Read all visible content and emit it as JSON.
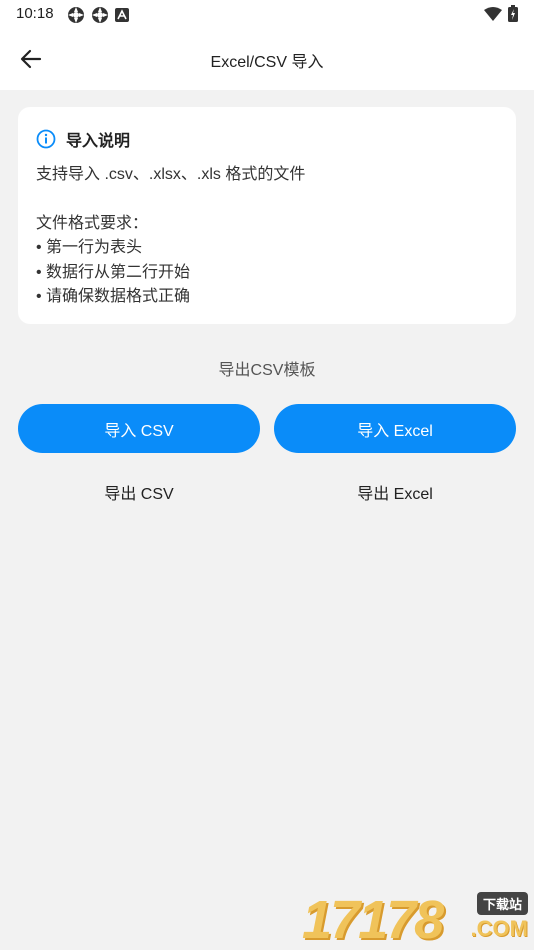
{
  "status_bar": {
    "time": "10:18",
    "left_icons": [
      "gear-icon",
      "gear-icon",
      "a-icon"
    ],
    "right_icons": [
      "wifi-icon",
      "battery-icon"
    ]
  },
  "app_bar": {
    "back_icon": "arrow-left-icon",
    "title": "Excel/CSV 导入"
  },
  "info_card": {
    "icon": "info-icon",
    "icon_color": "#0a8cf9",
    "title": "导入说明",
    "support_line": "支持导入 .csv、.xlsx、.xls 格式的文件",
    "requirements_heading": "文件格式要求：",
    "requirements": [
      "• 第一行为表头",
      "• 数据行从第二行开始",
      "• 请确保数据格式正确"
    ]
  },
  "template_link": "导出CSV模板",
  "actions": {
    "import_csv": "导入 CSV",
    "import_excel": "导入 Excel",
    "export_csv": "导出 CSV",
    "export_excel": "导出 Excel"
  },
  "watermark": {
    "digits": "17178",
    "badge": "下载站",
    "suffix": ".COM"
  },
  "colors": {
    "accent": "#0a8cf9",
    "background": "#f2f2f2",
    "card": "#ffffff"
  }
}
